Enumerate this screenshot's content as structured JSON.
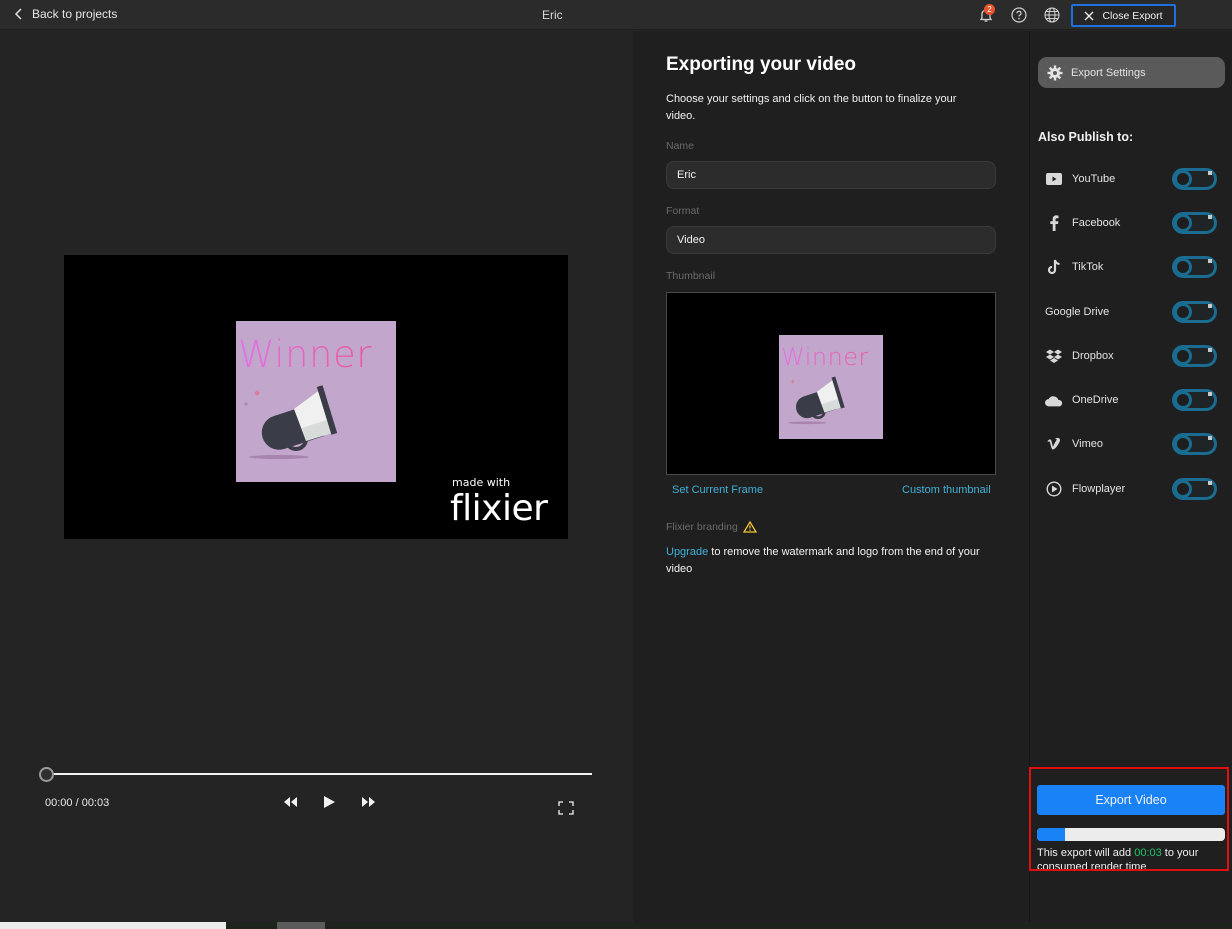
{
  "topbar": {
    "back_label": "Back to projects",
    "project_title": "Eric",
    "notification_count": "2",
    "close_export_label": "Close Export"
  },
  "preview": {
    "artwork_text": "Winner",
    "watermark_small": "made with",
    "watermark_brand": "flixier",
    "current_time": "00:00",
    "duration": "00:03",
    "time_display": "00:00 / 00:03",
    "playback_progress": 0
  },
  "settings": {
    "title": "Exporting your video",
    "intro": "Choose your settings and click on the button to finalize your video.",
    "name_label": "Name",
    "name_value": "Eric",
    "format_label": "Format",
    "format_value": "Video",
    "thumbnail_label": "Thumbnail",
    "set_current_frame": "Set Current Frame",
    "custom_thumbnail": "Custom thumbnail",
    "branding_label": "Flixier branding",
    "upgrade_link": "Upgrade",
    "upgrade_rest": " to remove the watermark and logo from the end of your video"
  },
  "sidebar": {
    "export_settings_label": "Export Settings",
    "also_publish_label": "Also Publish to:",
    "publish_targets": [
      {
        "label": "YouTube",
        "icon": "youtube-icon",
        "enabled": false
      },
      {
        "label": "Facebook",
        "icon": "facebook-icon",
        "enabled": false
      },
      {
        "label": "TikTok",
        "icon": "tiktok-icon",
        "enabled": false
      },
      {
        "label": "Google Drive",
        "icon": "",
        "enabled": false
      },
      {
        "label": "Dropbox",
        "icon": "dropbox-icon",
        "enabled": false
      },
      {
        "label": "OneDrive",
        "icon": "onedrive-icon",
        "enabled": false
      },
      {
        "label": "Vimeo",
        "icon": "vimeo-icon",
        "enabled": false
      },
      {
        "label": "Flowplayer",
        "icon": "flowplayer-icon",
        "enabled": false
      }
    ]
  },
  "export": {
    "button_label": "Export Video",
    "progress_percent": 15,
    "note_prefix": "This export will add ",
    "note_time": "00:03",
    "note_suffix": " to your consumed render time"
  },
  "colors": {
    "accent_blue": "#1a82f7",
    "link_cyan": "#3fb2d8",
    "toggle_border": "#1a6d91",
    "highlight_red": "#e01010",
    "render_time_green": "#22c46a",
    "warning_yellow": "#f2c230"
  }
}
